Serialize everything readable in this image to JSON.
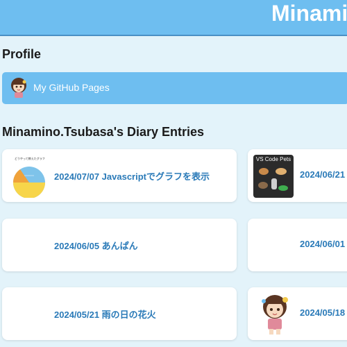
{
  "header": {
    "title": "Minamino"
  },
  "profile": {
    "heading": "Profile",
    "link_label": "My GitHub Pages"
  },
  "diary": {
    "heading": "Minamino.Tsubasa's Diary Entries",
    "entries": [
      {
        "label": "2024/07/07 Javascriptでグラフを表示",
        "thumb_caption": "どうやって教えたグラフ"
      },
      {
        "label": "2024/06/21",
        "thumb_caption": "VS Code Pets"
      },
      {
        "label": "2024/06/05 あんぱん"
      },
      {
        "label": "2024/06/01"
      },
      {
        "label": "2024/05/21 雨の日の花火"
      },
      {
        "label": "2024/05/18"
      }
    ]
  },
  "colors": {
    "page_background": "#e3f3fa",
    "header_background": "#6ebef0",
    "link_text": "#2a7ab8"
  }
}
